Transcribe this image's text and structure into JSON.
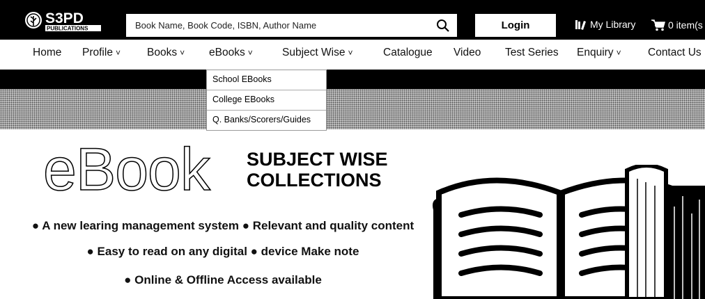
{
  "header": {
    "logo_top": "S3PD",
    "logo_bottom": "PUBLICATIONS",
    "search_placeholder": "Book Name, Book Code, ISBN, Author Name",
    "search_icon": "search-icon",
    "login_label": "Login",
    "my_library_label": "My Library",
    "my_library_icon": "library-icon",
    "cart_label": "0 item(s",
    "cart_icon": "cart-icon"
  },
  "nav": {
    "items": [
      {
        "label": "Home",
        "dropdown": false
      },
      {
        "label": "Profile",
        "dropdown": true
      },
      {
        "label": "Books",
        "dropdown": true
      },
      {
        "label": "eBooks",
        "dropdown": true
      },
      {
        "label": "Subject Wise",
        "dropdown": true
      },
      {
        "label": "Catalogue",
        "dropdown": false
      },
      {
        "label": "Video",
        "dropdown": false
      },
      {
        "label": "Test Series",
        "dropdown": false
      },
      {
        "label": "Enquiry",
        "dropdown": true
      },
      {
        "label": "Contact Us",
        "dropdown": false
      }
    ]
  },
  "ebooks_menu": {
    "items": [
      "School EBooks",
      "College EBooks",
      "Q. Banks/Scorers/Guides"
    ]
  },
  "banner": {
    "ebook_word": "eBook",
    "subject_line1": "SUBJECT WISE",
    "subject_line2": "COLLECTIONS",
    "features": [
      "● A new learing management system ● Relevant and quality content",
      "● Easy to read on any digital ● device Make note",
      "● Online & Offline Access available"
    ]
  },
  "colors": {
    "header_bg": "#000000",
    "accent": "#000000",
    "pattern": "#c9c9c9"
  }
}
